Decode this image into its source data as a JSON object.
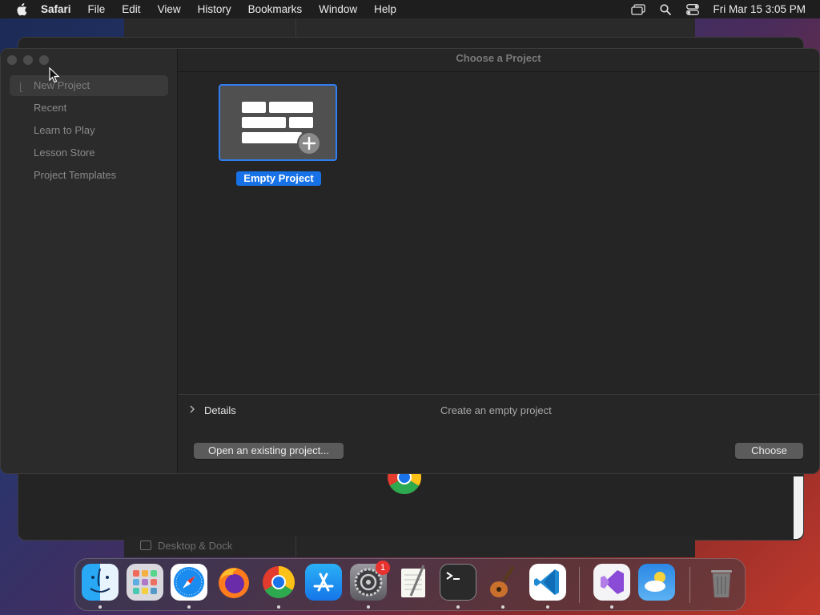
{
  "menubar": {
    "app_name": "Safari",
    "items": [
      "File",
      "Edit",
      "View",
      "History",
      "Bookmarks",
      "Window",
      "Help"
    ],
    "clock": "Fri Mar 15  3:05 PM",
    "status_icons": [
      "screen-mirroring-icon",
      "spotlight-search-icon",
      "control-center-icon"
    ]
  },
  "background": {
    "settings_row_label": "Desktop & Dock"
  },
  "dialog": {
    "title": "Choose a Project",
    "sidebar_items": [
      "New Project",
      "Recent",
      "Learn to Play",
      "Lesson Store",
      "Project Templates"
    ],
    "selected_sidebar_item": "New Project",
    "templates": [
      {
        "label": "Empty Project",
        "selected": true
      }
    ],
    "details_label": "Details",
    "details_description": "Create an empty project",
    "open_existing_label": "Open an existing project...",
    "choose_label": "Choose"
  },
  "dock": {
    "apps": [
      "Finder",
      "Launchpad",
      "Safari",
      "Firefox",
      "Google Chrome",
      "App Store",
      "System Settings",
      "TextEdit",
      "Terminal",
      "GarageBand",
      "Visual Studio Code",
      "Visual Studio",
      "Weather",
      "Trash"
    ],
    "system_settings_badge": "1"
  },
  "colors": {
    "accent": "#1672e6",
    "menubar_bg": "#1e1e1e",
    "dialog_bg": "#252525",
    "sidebar_bg": "#2b2b2b"
  }
}
